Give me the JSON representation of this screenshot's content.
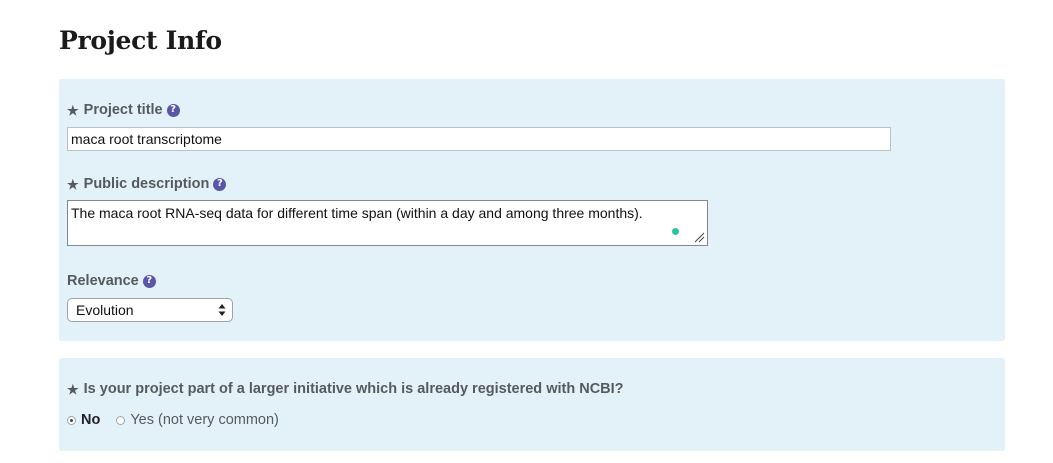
{
  "page": {
    "title": "Project Info"
  },
  "project_title": {
    "label": "Project title",
    "value": "maca root transcriptome",
    "required_icon": "asterisk-icon",
    "help_icon": "question-circle-icon"
  },
  "public_description": {
    "label": "Public description",
    "value": "The maca root RNA-seq data for different time span (within a day and among three months).",
    "required_icon": "asterisk-icon",
    "help_icon": "question-circle-icon"
  },
  "relevance": {
    "label": "Relevance",
    "selected": "Evolution",
    "help_icon": "question-circle-icon"
  },
  "initiative": {
    "question": "Is your project part of a larger initiative which is already registered with NCBI?",
    "options": [
      {
        "label": "No",
        "checked": true
      },
      {
        "label": "Yes (not very common)",
        "checked": false
      }
    ]
  },
  "colors": {
    "panel_bg": "#e3f2f8",
    "label_text": "#555a5e",
    "help_icon": "#5a56a8",
    "grammarly_dot": "#2ec4a3"
  }
}
